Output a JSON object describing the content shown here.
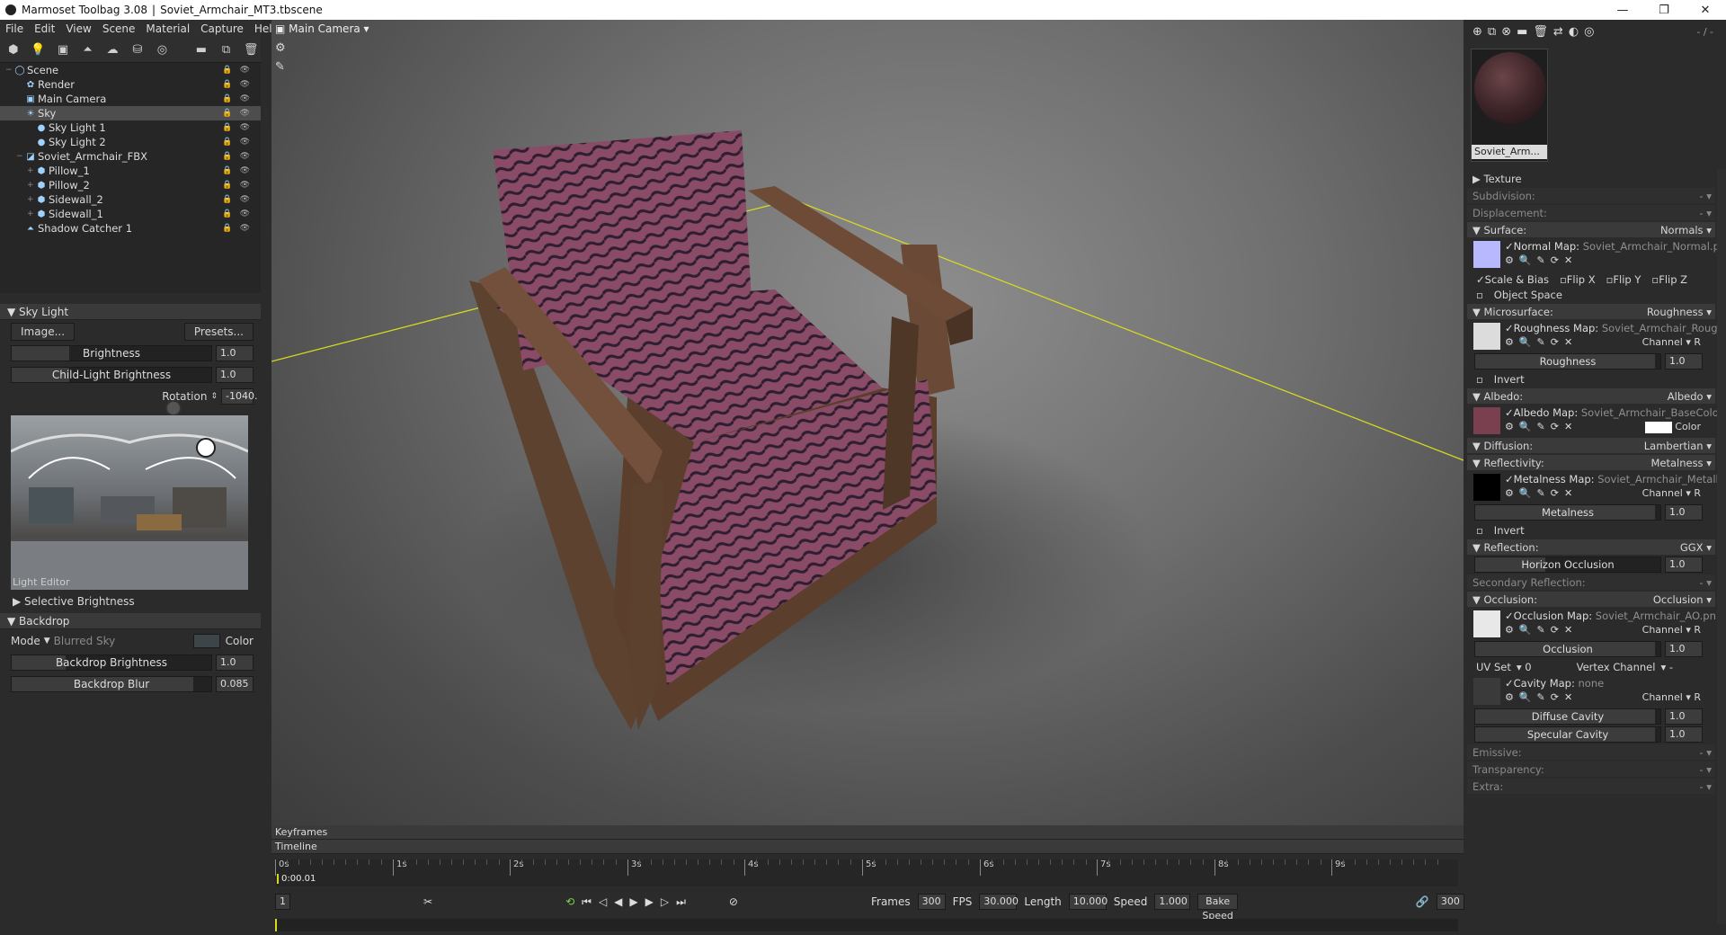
{
  "titlebar": {
    "app": "Marmoset Toolbag 3.08",
    "file": "Soviet_Armchair_MT3.tbscene",
    "separator": "|"
  },
  "menu": [
    "File",
    "Edit",
    "View",
    "Scene",
    "Material",
    "Capture",
    "Help"
  ],
  "viewport": {
    "camera_label": "Main Camera"
  },
  "scene_tree": [
    {
      "label": "Scene",
      "depth": 0,
      "icon": "scene-icon"
    },
    {
      "label": "Render",
      "depth": 1,
      "icon": "render-icon"
    },
    {
      "label": "Main Camera",
      "depth": 1,
      "icon": "camera-icon"
    },
    {
      "label": "Sky",
      "depth": 1,
      "icon": "sky-icon",
      "selected": true
    },
    {
      "label": "Sky Light 1",
      "depth": 2,
      "icon": "light-icon"
    },
    {
      "label": "Sky Light 2",
      "depth": 2,
      "icon": "light-icon"
    },
    {
      "label": "Soviet_Armchair_FBX",
      "depth": 1,
      "icon": "mesh-icon"
    },
    {
      "label": "Pillow_1",
      "depth": 2,
      "icon": "cube-icon"
    },
    {
      "label": "Pillow_2",
      "depth": 2,
      "icon": "cube-icon"
    },
    {
      "label": "Sidewall_2",
      "depth": 2,
      "icon": "cube-icon"
    },
    {
      "label": "Sidewall_1",
      "depth": 2,
      "icon": "cube-icon"
    },
    {
      "label": "Shadow Catcher 1",
      "depth": 1,
      "icon": "shadow-icon"
    }
  ],
  "sky_light": {
    "title": "Sky Light",
    "image_btn": "Image...",
    "presets_btn": "Presets...",
    "brightness_label": "Brightness",
    "brightness": "1.0",
    "child_brightness_label": "Child-Light Brightness",
    "child_brightness": "1.0",
    "rotation_label": "Rotation",
    "rotation": "-1040.",
    "light_editor_label": "Light Editor",
    "selective_brightness": "Selective Brightness"
  },
  "backdrop": {
    "title": "Backdrop",
    "mode_label": "Mode",
    "mode_value": "Blurred Sky",
    "color_label": "Color",
    "brightness_label": "Backdrop Brightness",
    "brightness": "1.0",
    "blur_label": "Backdrop Blur",
    "blur": "0.085"
  },
  "timeline": {
    "keyframes_label": "Keyframes",
    "timeline_label": "Timeline",
    "ticks": [
      "0s",
      "1s",
      "2s",
      "3s",
      "4s",
      "5s",
      "6s",
      "7s",
      "8s",
      "9s"
    ],
    "current_time": "0:00.01",
    "frame_field": "1",
    "frames_label": "Frames",
    "frames": "300",
    "fps_label": "FPS",
    "fps": "30.000",
    "length_label": "Length",
    "length": "10.000",
    "speed_label": "Speed",
    "speed": "1.000",
    "bake_speed": "Bake Speed",
    "end_frame": "300"
  },
  "material": {
    "name": "Soviet_Arm...",
    "counter": "- / -",
    "texture": "Texture",
    "subdivision": "Subdivision:",
    "subdivision_val": "-",
    "displacement": "Displacement:",
    "displacement_val": "-",
    "surface": "Surface:",
    "surface_val": "Normals",
    "normal_map": "Normal Map:",
    "normal_map_file": "Soviet_Armchair_Normal.p",
    "scale_bias": "Scale & Bias",
    "flip_x": "Flip X",
    "flip_y": "Flip Y",
    "flip_z": "Flip Z",
    "object_space": "Object Space",
    "microsurface": "Microsurface:",
    "microsurface_val": "Roughness",
    "roughness_map": "Roughness Map:",
    "roughness_map_file": "Soviet_Armchair_Rougl",
    "channel": "Channel",
    "channel_r": "R",
    "roughness": "Roughness",
    "roughness_val": "1.0",
    "invert": "Invert",
    "albedo": "Albedo:",
    "albedo_val": "Albedo",
    "albedo_map": "Albedo Map:",
    "albedo_map_file": "Soviet_Armchair_BaseColo",
    "color": "Color",
    "diffusion": "Diffusion:",
    "diffusion_val": "Lambertian",
    "reflectivity": "Reflectivity:",
    "reflectivity_val": "Metalness",
    "metalness_map": "Metalness Map:",
    "metalness_map_file": "Soviet_Armchair_Metalli",
    "metalness": "Metalness",
    "metalness_val": "1.0",
    "reflection": "Reflection:",
    "reflection_val": "GGX",
    "horizon_occlusion": "Horizon Occlusion",
    "horizon_val": "1.0",
    "secondary_reflection": "Secondary Reflection:",
    "secondary_val": "-",
    "occlusion": "Occlusion:",
    "occlusion_val": "Occlusion",
    "occlusion_map": "Occlusion Map:",
    "occlusion_map_file": "Soviet_Armchair_AO.pn",
    "occlusion_label": "Occlusion",
    "occlusion_num": "1.0",
    "uv_set": "UV Set",
    "uv_val": "0",
    "vertex_channel": "Vertex Channel",
    "vertex_val": "-",
    "cavity_map": "Cavity Map:",
    "cavity_map_file": "none",
    "diffuse_cavity": "Diffuse Cavity",
    "diffuse_cavity_val": "1.0",
    "specular_cavity": "Specular Cavity",
    "specular_cavity_val": "1.0",
    "emissive": "Emissive:",
    "emissive_val": "-",
    "transparency": "Transparency:",
    "transparency_val": "-",
    "extra": "Extra:",
    "extra_val": "-"
  },
  "colors": {
    "accent_yellow": "#d8d820",
    "fabric": "#8a4560",
    "wood": "#6b4a35",
    "normal_swatch": "#b8b8ff"
  }
}
